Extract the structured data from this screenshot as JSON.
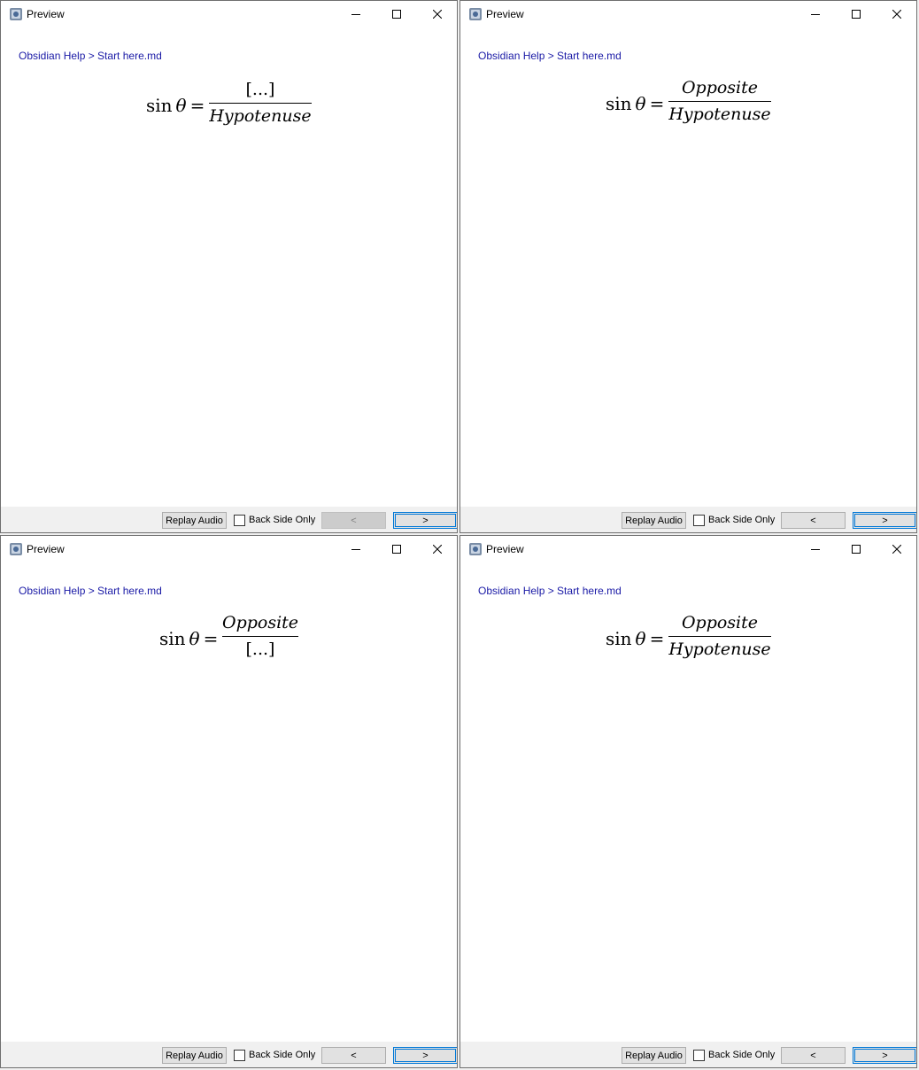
{
  "windows": [
    {
      "title": "Preview",
      "breadcrumb": "Obsidian Help > Start here.md",
      "formula": {
        "lhs_func": "sin",
        "lhs_var": "θ",
        "equals": "=",
        "numerator": "[...]",
        "denominator": "Hypotenuse"
      },
      "bottom": {
        "replay": "Replay Audio",
        "back_side_only": "Back Side Only",
        "prev": "<",
        "next": ">",
        "prev_disabled": true
      }
    },
    {
      "title": "Preview",
      "breadcrumb": "Obsidian Help > Start here.md",
      "formula": {
        "lhs_func": "sin",
        "lhs_var": "θ",
        "equals": "=",
        "numerator": "Opposite",
        "denominator": "Hypotenuse"
      },
      "bottom": {
        "replay": "Replay Audio",
        "back_side_only": "Back Side Only",
        "prev": "<",
        "next": ">",
        "prev_disabled": false
      }
    },
    {
      "title": "Preview",
      "breadcrumb": "Obsidian Help > Start here.md",
      "formula": {
        "lhs_func": "sin",
        "lhs_var": "θ",
        "equals": "=",
        "numerator": "Opposite",
        "denominator": "[...]"
      },
      "bottom": {
        "replay": "Replay Audio",
        "back_side_only": "Back Side Only",
        "prev": "<",
        "next": ">",
        "prev_disabled": false
      }
    },
    {
      "title": "Preview",
      "breadcrumb": "Obsidian Help > Start here.md",
      "formula": {
        "lhs_func": "sin",
        "lhs_var": "θ",
        "equals": "=",
        "numerator": "Opposite",
        "denominator": "Hypotenuse"
      },
      "bottom": {
        "replay": "Replay Audio",
        "back_side_only": "Back Side Only",
        "prev": "<",
        "next": ">",
        "prev_disabled": false
      }
    }
  ],
  "colors": {
    "breadcrumb": "#1a1aa6",
    "focus_border": "#0078d7",
    "bar_bg": "#f0f0f0"
  },
  "icons": {
    "app": "anki-app-icon",
    "minimize": "minimize-icon",
    "maximize": "maximize-icon",
    "close": "close-icon"
  }
}
